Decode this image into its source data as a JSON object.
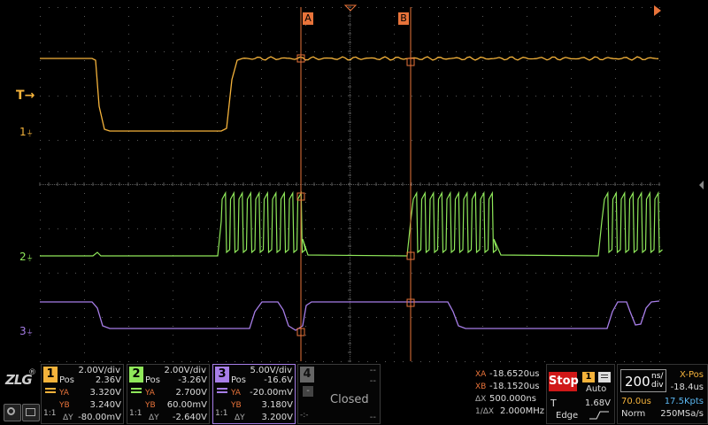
{
  "cursors": {
    "a_label": "A",
    "b_label": "B"
  },
  "markers": {
    "trigger": "T",
    "ch1": "1",
    "ch2": "2",
    "ch3": "3"
  },
  "colors": {
    "ch1": "#f5b33b",
    "ch2": "#8fe85a",
    "ch3": "#a77ee8",
    "cursor": "#e8733a",
    "grid": "#5a5a5a",
    "ch4": "#555555"
  },
  "channels": [
    {
      "num": "1",
      "vdiv": "2.00V/div",
      "pos_label": "Pos",
      "pos": "2.36V",
      "ya_label": "YA",
      "ya": "3.320V",
      "yb_label": "YB",
      "yb": "3.240V",
      "coupling": "1:1",
      "dy_label": "ΔY",
      "dy": "-80.00mV"
    },
    {
      "num": "2",
      "vdiv": "2.00V/div",
      "pos_label": "Pos",
      "pos": "-3.26V",
      "ya_label": "YA",
      "ya": "2.700V",
      "yb_label": "YB",
      "yb": "60.00mV",
      "coupling": "1:1",
      "dy_label": "ΔY",
      "dy": "-2.640V"
    },
    {
      "num": "3",
      "vdiv": "5.00V/div",
      "pos_label": "Pos",
      "pos": "-16.6V",
      "ya_label": "YA",
      "ya": "-20.00mV",
      "yb_label": "YB",
      "yb": "3.180V",
      "coupling": "1:1",
      "dy_label": "ΔY",
      "dy": "3.200V"
    }
  ],
  "ch4": {
    "num": "4",
    "vdiv": "--",
    "pos": "--",
    "status": "Closed",
    "dash": "--",
    "minus": "-",
    "coupling": "-:-"
  },
  "measure": {
    "xa_label": "XA",
    "xa": "-18.6520us",
    "xb_label": "XB",
    "xb": "-18.1520us",
    "dx_label": "ΔX",
    "dx": "500.000ns",
    "f_label": "1/ΔX",
    "f": "2.000MHz"
  },
  "trigger": {
    "state": "Stop",
    "source": "1",
    "mode": "Auto",
    "t_label": "T",
    "level": "1.68V",
    "type": "Edge"
  },
  "timebase": {
    "value": "200",
    "unit_top": "ns/",
    "unit_bottom": "div",
    "delay": "70.0us",
    "memory": "17.5Kpts",
    "mode": "Norm",
    "rate": "250MSa/s",
    "xpos_label": "X-Pos",
    "xpos": "-18.4us"
  },
  "brand": {
    "logo": "ZLG",
    "reg": "®"
  }
}
